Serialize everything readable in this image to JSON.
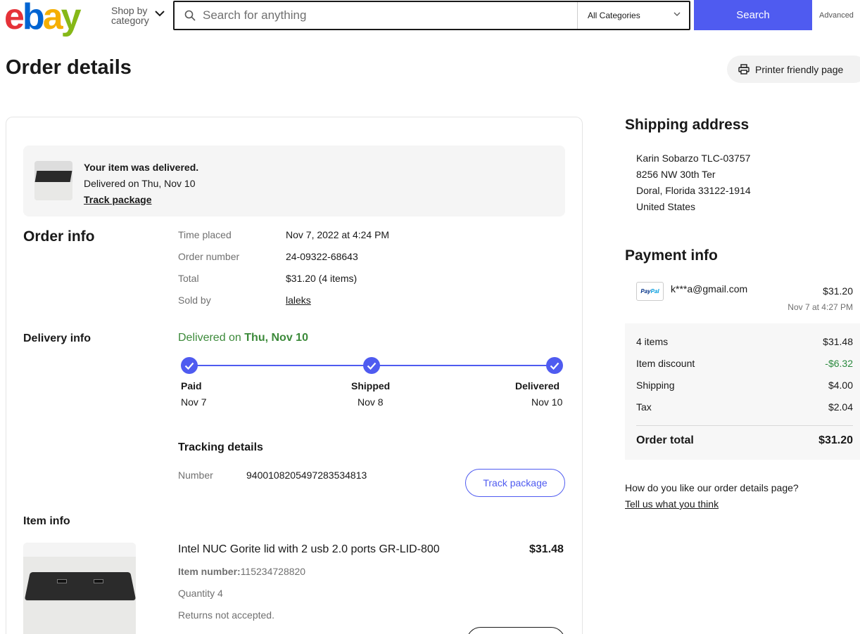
{
  "header": {
    "logo_letters": [
      "e",
      "b",
      "a",
      "y"
    ],
    "logo_colors": [
      "#e53238",
      "#0064d2",
      "#f5af02",
      "#86b817"
    ],
    "shop_by_category_line1": "Shop by",
    "shop_by_category_line2": "category",
    "search_placeholder": "Search for anything",
    "category_select": "All Categories",
    "search_button": "Search",
    "advanced_link": "Advanced"
  },
  "page": {
    "title": "Order details",
    "printer_button": "Printer friendly page"
  },
  "delivery_banner": {
    "headline": "Your item was delivered.",
    "subline": "Delivered on Thu, Nov 10",
    "link": "Track package"
  },
  "order_info": {
    "title": "Order info",
    "rows": [
      {
        "label": "Time placed",
        "value": "Nov 7, 2022 at 4:24 PM"
      },
      {
        "label": "Order number",
        "value": "24-09322-68643"
      },
      {
        "label": "Total",
        "value": "$31.20 (4 items)"
      },
      {
        "label": "Sold by",
        "value": "laleks"
      }
    ]
  },
  "delivery_info": {
    "title": "Delivery info",
    "status_prefix": "Delivered on ",
    "status_date": "Thu, Nov 10",
    "steps": [
      {
        "label": "Paid",
        "date": "Nov 7"
      },
      {
        "label": "Shipped",
        "date": "Nov 8"
      },
      {
        "label": "Delivered",
        "date": "Nov 10"
      }
    ],
    "tracking_title": "Tracking details",
    "tracking_label": "Number",
    "tracking_number": "9400108205497283534813",
    "track_button": "Track package"
  },
  "item_info": {
    "title": "Item info",
    "item_title": "Intel NUC Gorite lid with 2 usb 2.0 ports GR-LID-800",
    "price": "$31.48",
    "item_number_label": "Item number:",
    "item_number": "115234728820",
    "quantity": "Quantity 4",
    "returns": "Returns not accepted."
  },
  "shipping": {
    "title": "Shipping address",
    "lines": [
      "Karin Sobarzo TLC-03757",
      "8256 NW 30th Ter",
      "Doral, Florida 33122-1914",
      "United States"
    ]
  },
  "payment": {
    "title": "Payment info",
    "method_logo_a": "Pay",
    "method_logo_b": "Pal",
    "email": "k***a@gmail.com",
    "amount": "$31.20",
    "date": "Nov 7 at 4:27 PM",
    "summary": [
      {
        "label": "4 items",
        "value": "$31.48"
      },
      {
        "label": "Item discount",
        "value": "-$6.32"
      },
      {
        "label": "Shipping",
        "value": "$4.00"
      },
      {
        "label": "Tax",
        "value": "$2.04"
      }
    ],
    "total_label": "Order total",
    "total_value": "$31.20"
  },
  "feedback": {
    "question": "How do you like our order details page?",
    "link": "Tell us what you think"
  },
  "colors": {
    "accent": "#4f5bf0",
    "success": "#3c8a3a"
  }
}
